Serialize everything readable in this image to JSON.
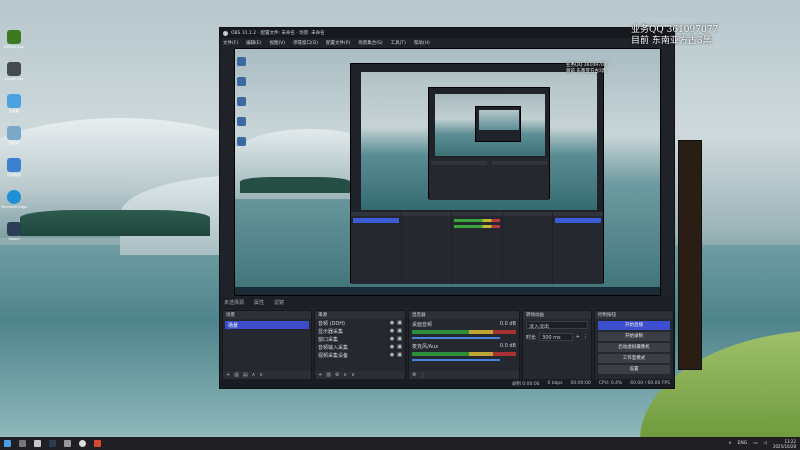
{
  "desktop": {
    "icons": [
      {
        "label": "NVIDIA App",
        "icon": "nvidia-icon",
        "color": "#3b7a1e"
      },
      {
        "label": "Screen Rec",
        "icon": "app-icon",
        "color": "#444a52"
      },
      {
        "label": "此电脑",
        "icon": "computer-icon",
        "color": "#4aa3e0"
      },
      {
        "label": "回收站",
        "icon": "recycle-bin-icon",
        "color": "#7aa8c8"
      },
      {
        "label": "控制面板",
        "icon": "control-panel-icon",
        "color": "#3a7fd0"
      },
      {
        "label": "Microsoft Edge",
        "icon": "edge-icon",
        "color": "#1f8fd6"
      },
      {
        "label": "Steam",
        "icon": "steam-icon",
        "color": "#2a3d55"
      }
    ]
  },
  "watermark": {
    "line1": "业务QQ 361097077",
    "line2": "目前 东南亚方古3黑"
  },
  "obs": {
    "title": "OBS 31.1.2 · 配置文件: 未命名 · 场景: 未命名",
    "menu": [
      "文件(F)",
      "编辑(E)",
      "视图(V)",
      "停靠窗口(D)",
      "配置文件(P)",
      "场景集合(S)",
      "工具(T)",
      "帮助(H)"
    ],
    "dock_tabs": [
      "未选择源",
      "属性",
      "滤镜"
    ],
    "scenes": {
      "title": "场景",
      "items": [
        "场景"
      ]
    },
    "sources": {
      "title": "来源",
      "items": [
        "音频 (DDH)",
        "显示器采集",
        "窗口采集",
        "音频输入采集",
        "视频采集设备"
      ]
    },
    "mixer": {
      "title": "混音器",
      "channels": [
        {
          "name": "桌面音频",
          "db": "0.0 dB"
        },
        {
          "name": "麦克风/Aux",
          "db": "0.0 dB"
        }
      ]
    },
    "transitions": {
      "title": "转场动画",
      "type": "淡入淡出",
      "duration_label": "时长",
      "duration": "300 ms"
    },
    "controls": {
      "title": "控制按钮",
      "buttons": [
        "开始直播",
        "开始录制",
        "启动虚拟摄像机",
        "工作室模式",
        "设置"
      ]
    },
    "status": {
      "items": [
        "录制 0:00:00",
        "0 kbps",
        "00:00:00",
        "CPU: 0.4%",
        "60.00 / 60.00 FPS"
      ]
    }
  },
  "taskbar": {
    "language": "ENG",
    "time": "13:22",
    "date": "2025/10/28"
  }
}
